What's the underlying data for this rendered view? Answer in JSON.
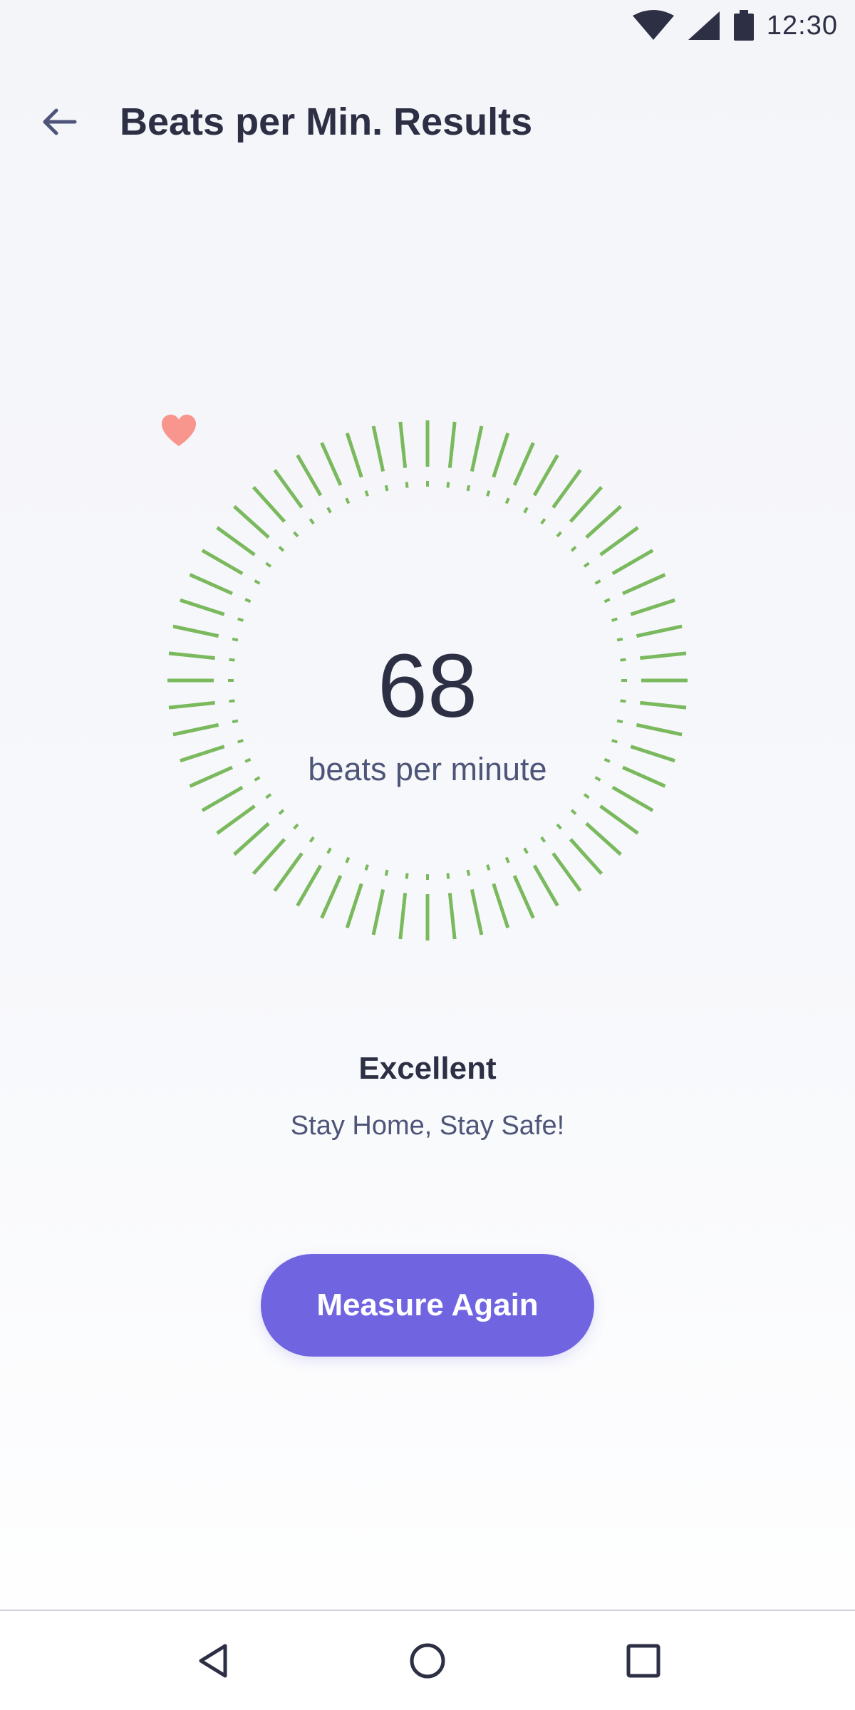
{
  "status_bar": {
    "time": "12:30",
    "icons": [
      "wifi-icon",
      "signal-icon",
      "battery-icon"
    ]
  },
  "header": {
    "back_icon": "arrow-left-icon",
    "title": "Beats per Min. Results"
  },
  "gauge": {
    "icon": "heart-icon",
    "value": "68",
    "unit": "beats per minute",
    "tick_count": 60
  },
  "result": {
    "title": "Excellent",
    "subtitle": "Stay Home, Stay Safe!"
  },
  "actions": {
    "measure_again_label": "Measure Again"
  },
  "navigation": {
    "icons": [
      "nav-back-icon",
      "nav-home-icon",
      "nav-recents-icon"
    ]
  },
  "colors": {
    "accent": "#7064e1",
    "gauge_green": "#7ab95d",
    "heart": "#f8958c",
    "text_primary": "#2d2f44",
    "text_secondary": "#4e5579"
  }
}
